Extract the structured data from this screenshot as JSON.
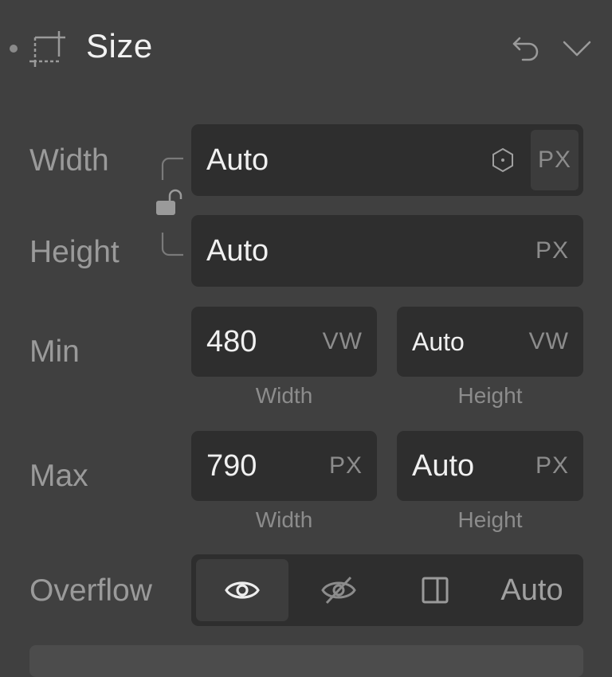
{
  "section": {
    "title": "Size",
    "icons": {
      "section": "crop-frame-icon",
      "reset": "undo-icon",
      "collapse": "chevron-down-icon"
    }
  },
  "width": {
    "label": "Width",
    "value": "Auto",
    "unit": "PX",
    "icon": "hexagon-dot-icon"
  },
  "height": {
    "label": "Height",
    "value": "Auto",
    "unit": "PX"
  },
  "link": {
    "icon": "unlock-icon"
  },
  "min": {
    "label": "Min",
    "width": {
      "value": "480",
      "unit": "VW",
      "sublabel": "Width"
    },
    "height": {
      "value": "Auto",
      "unit": "VW",
      "sublabel": "Height"
    }
  },
  "max": {
    "label": "Max",
    "width": {
      "value": "790",
      "unit": "PX",
      "sublabel": "Width"
    },
    "height": {
      "value": "Auto",
      "unit": "PX",
      "sublabel": "Height"
    }
  },
  "overflow": {
    "label": "Overflow",
    "options": [
      {
        "name": "visible",
        "icon": "eye-icon",
        "active": true
      },
      {
        "name": "hidden",
        "icon": "eye-slash-icon",
        "active": false
      },
      {
        "name": "scroll",
        "icon": "scroll-panel-icon",
        "active": false
      },
      {
        "name": "auto",
        "label": "Auto",
        "active": false
      }
    ]
  }
}
